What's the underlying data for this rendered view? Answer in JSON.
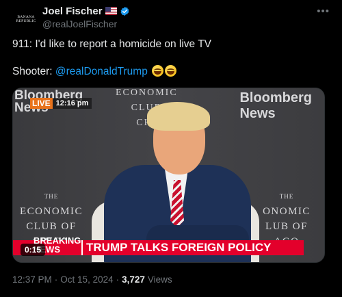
{
  "author": {
    "avatar_line1": "BANANA",
    "avatar_line2": "REPUBLIC",
    "display_name": "Joel Fischer",
    "handle": "@realJoelFischer",
    "flag_icon": "us-flag-icon",
    "verified_icon": "verified-badge-icon"
  },
  "more_label": "•••",
  "tweet": {
    "line1": "911: I'd like to report a homicide on live TV",
    "line2_prefix": "Shooter: ",
    "mention": "@realDonaldTrump",
    "emoji": "laughing-with-tears-emoji"
  },
  "video": {
    "bloomberg_left_line1": "Bloomberg",
    "bloomberg_left_line2": "News",
    "bloomberg_right_line1": "Bloomberg",
    "bloomberg_right_line2": "News",
    "live_label": "LIVE",
    "live_time": "12:16 pm",
    "club_top_line1": "ECONOMIC",
    "club_top_line2": "CLUB",
    "club_top_line3": "CHI",
    "club_left_the": "THE",
    "club_left_economic": "ECONOMIC",
    "club_left_club": "CLUB OF",
    "club_left_chicago": "CHICA",
    "club_right_the": "THE",
    "club_right_economic": "ONOMIC",
    "club_right_club": "LUB OF",
    "club_right_chicago": "AGO",
    "breaking_label": "BREAKING NEWS",
    "headline": "TRUMP TALKS FOREIGN POLICY",
    "duration": "0:15"
  },
  "meta": {
    "time": "12:37 PM",
    "separator": "·",
    "date": "Oct 15, 2024",
    "views_count": "3,727",
    "views_label": "Views"
  },
  "colors": {
    "background": "#000000",
    "text": "#e7e9ea",
    "secondary": "#71767b",
    "link": "#1d9bf0",
    "breaking_red": "#e3002b",
    "live_orange": "#e8731c"
  }
}
